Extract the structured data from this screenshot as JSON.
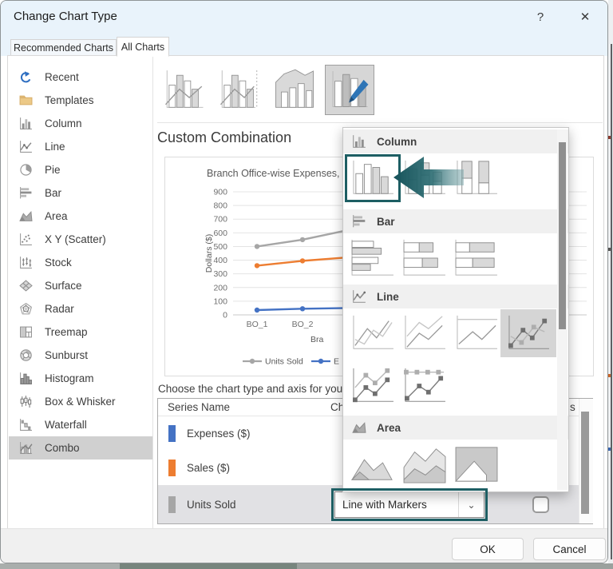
{
  "window": {
    "title": "Change Chart Type",
    "help_icon": "?",
    "close_icon": "✕"
  },
  "tabs": [
    {
      "label": "Recommended Charts",
      "active": false
    },
    {
      "label": "All Charts",
      "active": true
    }
  ],
  "sidebar": {
    "items": [
      {
        "label": "Recent",
        "icon": "recent-icon",
        "selected": false
      },
      {
        "label": "Templates",
        "icon": "templates-icon",
        "selected": false
      },
      {
        "label": "Column",
        "icon": "column-icon",
        "selected": false
      },
      {
        "label": "Line",
        "icon": "line-icon",
        "selected": false
      },
      {
        "label": "Pie",
        "icon": "pie-icon",
        "selected": false
      },
      {
        "label": "Bar",
        "icon": "bar-icon",
        "selected": false
      },
      {
        "label": "Area",
        "icon": "area-icon",
        "selected": false
      },
      {
        "label": "X Y (Scatter)",
        "icon": "scatter-icon",
        "selected": false
      },
      {
        "label": "Stock",
        "icon": "stock-icon",
        "selected": false
      },
      {
        "label": "Surface",
        "icon": "surface-icon",
        "selected": false
      },
      {
        "label": "Radar",
        "icon": "radar-icon",
        "selected": false
      },
      {
        "label": "Treemap",
        "icon": "treemap-icon",
        "selected": false
      },
      {
        "label": "Sunburst",
        "icon": "sunburst-icon",
        "selected": false
      },
      {
        "label": "Histogram",
        "icon": "histogram-icon",
        "selected": false
      },
      {
        "label": "Box & Whisker",
        "icon": "box-whisker-icon",
        "selected": false
      },
      {
        "label": "Waterfall",
        "icon": "waterfall-icon",
        "selected": false
      },
      {
        "label": "Combo",
        "icon": "combo-icon",
        "selected": true
      }
    ]
  },
  "gallery": {
    "thumbnails": [
      {
        "name": "clustered-column-line-combo",
        "selected": false
      },
      {
        "name": "clustered-column-line-secondary-axis-combo",
        "selected": false
      },
      {
        "name": "stacked-area-clustered-column-combo",
        "selected": false
      },
      {
        "name": "custom-combination-combo",
        "selected": true
      }
    ]
  },
  "main": {
    "heading": "Custom Combination",
    "prompt": "Choose the chart type and axis for your",
    "series_table": {
      "columns": [
        "Series Name",
        "Cha",
        "s"
      ],
      "rows": [
        {
          "name": "Expenses ($)",
          "color": "#4472c4",
          "selected": false
        },
        {
          "name": "Sales ($)",
          "color": "#ed7d31",
          "selected": false
        },
        {
          "name": "Units Sold",
          "color": "#a6a6a6",
          "selected": true,
          "chart_type_value": "Line with Markers",
          "secondary_axis_checked": false
        }
      ]
    }
  },
  "flyout": {
    "sections": [
      {
        "label": "Column",
        "icon": "column-icon",
        "items": [
          {
            "name": "clustered-column",
            "annotated": true
          },
          {
            "name": "stacked-column"
          },
          {
            "name": "hundred-stacked-column"
          }
        ]
      },
      {
        "label": "Bar",
        "icon": "bar-icon",
        "items": [
          {
            "name": "clustered-bar"
          },
          {
            "name": "stacked-bar"
          },
          {
            "name": "hundred-stacked-bar"
          }
        ]
      },
      {
        "label": "Line",
        "icon": "line-flyout-icon",
        "items": [
          {
            "name": "line"
          },
          {
            "name": "stacked-line"
          },
          {
            "name": "hundred-stacked-line"
          },
          {
            "name": "line-with-markers",
            "selected": true
          },
          {
            "name": "stacked-line-with-markers"
          },
          {
            "name": "hundred-stacked-line-with-markers"
          }
        ]
      },
      {
        "label": "Area",
        "icon": "area-flyout-icon",
        "items": [
          {
            "name": "area"
          },
          {
            "name": "stacked-area"
          },
          {
            "name": "hundred-stacked-area"
          }
        ]
      }
    ]
  },
  "combobox": {
    "value": "Line with Markers",
    "chevron_icon": "⌄"
  },
  "footer": {
    "ok_label": "OK",
    "cancel_label": "Cancel"
  },
  "colors": {
    "annotation_teal": "#1d5e63",
    "series_blue": "#4472c4",
    "series_orange": "#ed7d31",
    "series_gray": "#a6a6a6",
    "titlebar_blue": "#e9f3fb",
    "selection_gray": "#d0d0d0"
  },
  "chart_data": {
    "type": "line",
    "title": "Branch Office-wise Expenses, S",
    "ylabel": "Dollars ($)",
    "xlabel_visible": "Bra",
    "ylim": [
      0,
      900
    ],
    "ytick_step": 100,
    "yticks": [
      0,
      100,
      200,
      300,
      400,
      500,
      600,
      700,
      800,
      900
    ],
    "categories_visible": [
      "BO_1",
      "BO_2"
    ],
    "grid": true,
    "legend_position": "bottom",
    "legend_visible": [
      {
        "label": "Units Sold",
        "color": "#a6a6a6"
      },
      {
        "label": "E",
        "color": "#4472c4"
      }
    ],
    "series": [
      {
        "name": "Units Sold",
        "color": "#a6a6a6",
        "values": [
          500,
          550,
          620
        ]
      },
      {
        "name": "Sales ($)",
        "color": "#ed7d31",
        "values": [
          360,
          395,
          420
        ]
      },
      {
        "name": "Expenses ($)",
        "color": "#4472c4",
        "values": [
          35,
          45,
          50
        ]
      }
    ]
  }
}
